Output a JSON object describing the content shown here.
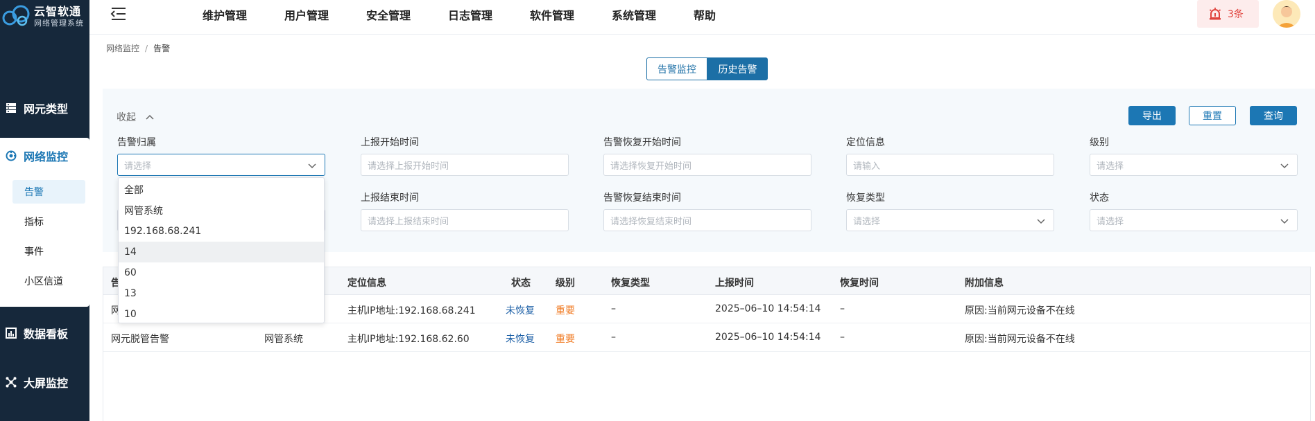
{
  "app": {
    "brand_name": "云智软通",
    "brand_sub": "网络管理系统"
  },
  "sidebar": {
    "items": [
      {
        "label": "网元类型",
        "icon": "server-icon"
      },
      {
        "label": "网络监控",
        "icon": "network-monitor-icon"
      },
      {
        "label": "数据看板",
        "icon": "chart-icon"
      },
      {
        "label": "大屏监控",
        "icon": "screen-monitor-icon"
      }
    ],
    "subitems": [
      "告警",
      "指标",
      "事件",
      "小区信道"
    ]
  },
  "topnav": {
    "menu": [
      "维护管理",
      "用户管理",
      "安全管理",
      "日志管理",
      "软件管理",
      "系统管理",
      "帮助"
    ],
    "alarm_count": "3条"
  },
  "breadcrumb": {
    "parent": "网络监控",
    "separator": "/",
    "current": "告警"
  },
  "tabs": {
    "left": "告警监控",
    "right": "历史告警"
  },
  "filter": {
    "collapse_label": "收起",
    "buttons": {
      "export": "导出",
      "reset": "重置",
      "query": "查询"
    },
    "row1": [
      {
        "label": "告警归属",
        "placeholder": "请选择"
      },
      {
        "label": "上报开始时间",
        "placeholder": "请选择上报开始时间"
      },
      {
        "label": "告警恢复开始时间",
        "placeholder": "请选择恢复开始时间"
      },
      {
        "label": "定位信息",
        "placeholder": "请输入"
      },
      {
        "label": "级别",
        "placeholder": "请选择"
      }
    ],
    "row2": [
      {
        "label": "上报结束时间",
        "placeholder": "请选择上报结束时间"
      },
      {
        "label": "告警恢复结束时间",
        "placeholder": "请选择恢复结束时间"
      },
      {
        "label": "恢复类型",
        "placeholder": "请选择"
      },
      {
        "label": "状态",
        "placeholder": "请选择"
      }
    ]
  },
  "dropdown": {
    "options": [
      "全部",
      "网管系统",
      "192.168.68.241",
      "14",
      "60",
      "13",
      "10"
    ],
    "hovered": "14"
  },
  "table": {
    "headers": [
      "告",
      "定位信息",
      "状态",
      "级别",
      "恢复类型",
      "上报时间",
      "恢复时间",
      "附加信息"
    ],
    "rows": [
      {
        "name": "网",
        "owner": "",
        "location": "主机IP地址:192.168.68.241",
        "status": "未恢复",
        "level": "重要",
        "recover_type": "–",
        "report_time": "2025–06–10 14:54:14",
        "recover_time": "–",
        "extra": "原因:当前网元设备不在线"
      },
      {
        "name": "网元脱管告警",
        "owner": "网管系统",
        "location": "主机IP地址:192.168.62.60",
        "status": "未恢复",
        "level": "重要",
        "recover_type": "–",
        "report_time": "2025–06–10 14:54:14",
        "recover_time": "–",
        "extra": "原因:当前网元设备不在线"
      }
    ]
  },
  "colors": {
    "sidebar_bg": "#16283b",
    "primary": "#1c77b4",
    "danger": "#e0443e",
    "warning": "#f07a22"
  }
}
